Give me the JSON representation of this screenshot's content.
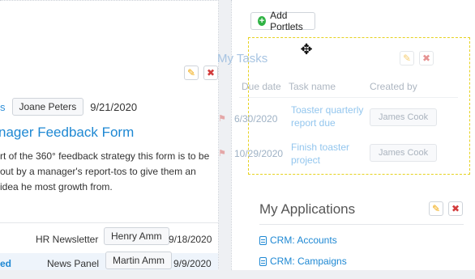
{
  "left": {
    "meta": {
      "blue_snippet": "s",
      "author": "Joane Peters",
      "date": "9/21/2020"
    },
    "form_title": "nager Feedback Form",
    "description": "rt of the 360° feedback strategy this form is to be out by a manager's report-tos to give them an idea he most growth from.",
    "rows": [
      {
        "title": "",
        "type": "HR Newsletter",
        "author": "Henry Amm",
        "date": "9/18/2020"
      },
      {
        "title": "ed",
        "type": "News Panel",
        "author": "Martin Amm",
        "date": "9/9/2020"
      }
    ]
  },
  "right": {
    "add_portlets_label": "Add Portlets",
    "my_applications": {
      "title": "My Applications",
      "links": [
        "CRM: Accounts",
        "CRM: Campaigns"
      ]
    }
  },
  "dragging_portlet": {
    "title": "My Tasks",
    "columns": [
      "Due date",
      "Task name",
      "Created by"
    ],
    "rows": [
      {
        "due_date": "6/30/2020",
        "task_name": "Toaster quarterly report due",
        "created_by": "James Cook"
      },
      {
        "due_date": "10/29/2020",
        "task_name": "Finish toaster project",
        "created_by": "James Cook"
      }
    ]
  },
  "icons": {
    "edit": "pencil-icon",
    "delete": "close-icon",
    "add": "plus-circle-icon",
    "app": "database-icon",
    "cursor": "move-cursor-icon"
  },
  "colors": {
    "accent_blue": "#1e88d3",
    "delete_red": "#d23b3b",
    "edit_orange": "#f0a500",
    "add_green": "#2fb344",
    "drop_outline": "#e6d21f"
  }
}
